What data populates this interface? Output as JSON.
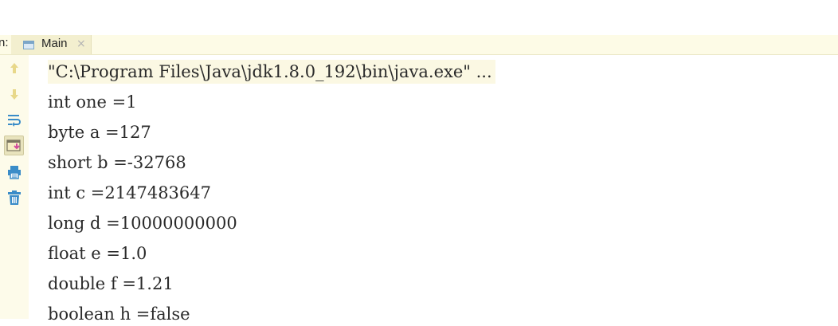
{
  "tabbar": {
    "run_label": "n:",
    "tab": {
      "label": "Main",
      "close": "×"
    }
  },
  "toolbar": {
    "buttons": [
      {
        "name": "up-arrow-icon"
      },
      {
        "name": "down-arrow-icon"
      },
      {
        "name": "soft-wrap-icon"
      },
      {
        "name": "scroll-to-end-icon",
        "active": true
      },
      {
        "name": "print-icon"
      },
      {
        "name": "trash-icon"
      }
    ]
  },
  "console": {
    "lines": [
      "\"C:\\Program Files\\Java\\jdk1.8.0_192\\bin\\java.exe\" ...",
      "int one =1",
      "byte a =127",
      "short b =-32768",
      "int c =2147483647",
      "long d =10000000000",
      "float e =1.0",
      "double f =1.21",
      "boolean h =false"
    ]
  },
  "colors": {
    "toolbar_bg": "#fdfbea",
    "tabbar_bg": "#fdfbe6",
    "icon_blue": "#3a8cc8",
    "icon_yellow": "#e8d88a"
  }
}
